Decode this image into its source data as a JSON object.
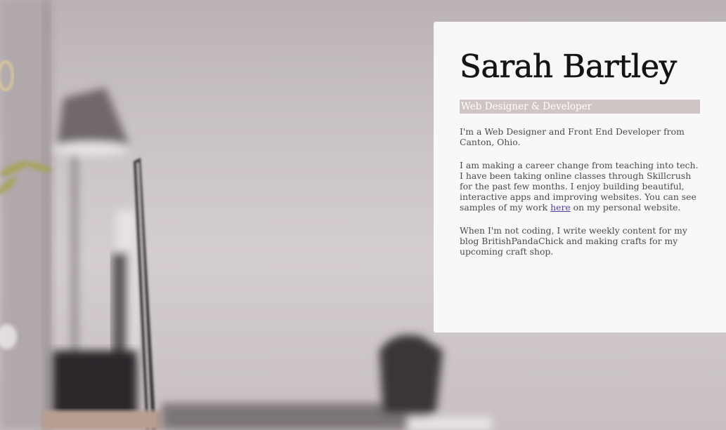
{
  "profile": {
    "name": "Sarah Bartley",
    "subtitle": "Web Designer & Developer",
    "intro": "I'm a Web Designer and Front End Developer from Canton, Ohio.",
    "career_before_link": "I am making a career change from teaching into tech. I have been taking online classes through Skillcrush for the past few months. I enjoy building beautiful, interactive apps and improving websites. You can see samples of my work ",
    "career_link": "here",
    "career_after_link": " on my personal website.",
    "hobbies": "When I'm not coding, I write weekly content for my blog BritishPandaChick and making crafts for my upcoming craft shop."
  },
  "colors": {
    "card_background": "#fafafa",
    "subtitle_background": "#cfc5c2",
    "link": "#4b3fa8",
    "heading": "#141414",
    "body_text": "#4a4a4a"
  }
}
